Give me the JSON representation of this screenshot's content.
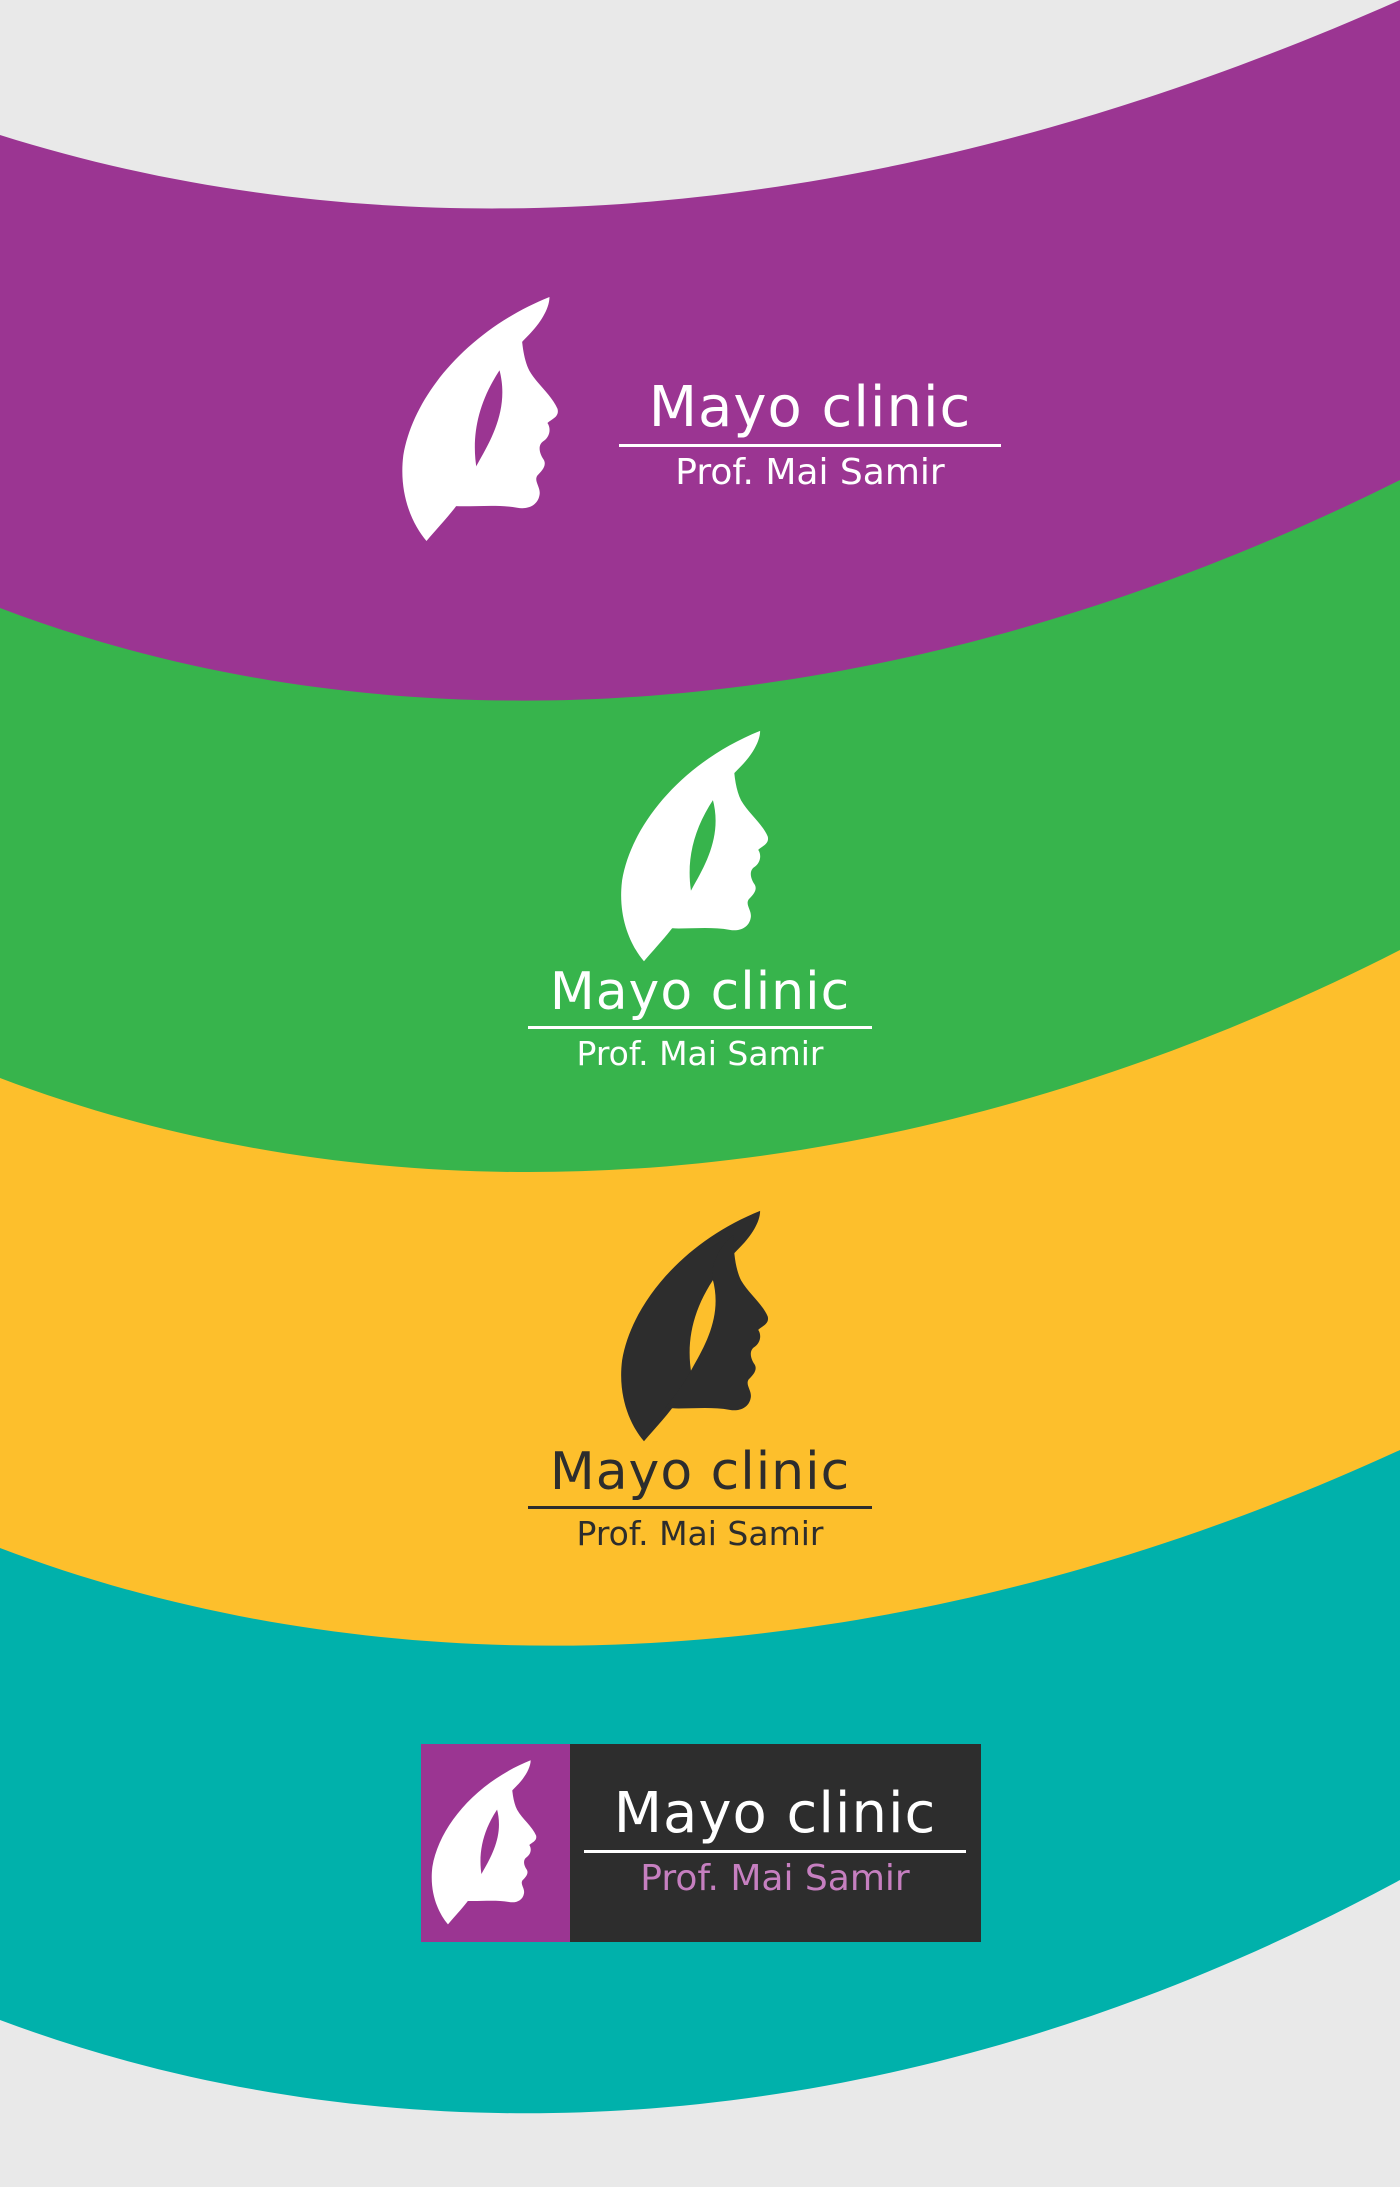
{
  "colors": {
    "background": "#e9e9e9",
    "purple": "#9b3592",
    "green": "#37b44c",
    "yellow": "#fdbf2c",
    "teal": "#00b1ab",
    "dark": "#2d2d2d",
    "white": "#ffffff",
    "pink_text": "#c67fc0"
  },
  "bands": [
    {
      "name": "purple-band",
      "color": "#9b3592"
    },
    {
      "name": "green-band",
      "color": "#37b44c"
    },
    {
      "name": "yellow-band",
      "color": "#fdbf2c"
    },
    {
      "name": "teal-band",
      "color": "#00b1ab"
    }
  ],
  "logos": [
    {
      "icon": "leaf-face-icon",
      "title": "Mayo clinic",
      "subtitle": "Prof. Mai Samir",
      "variant": "white-on-purple"
    },
    {
      "icon": "leaf-face-icon",
      "title": "Mayo clinic",
      "subtitle": "Prof. Mai Samir",
      "variant": "white-on-green"
    },
    {
      "icon": "leaf-face-icon",
      "title": "Mayo clinic",
      "subtitle": "Prof. Mai Samir",
      "variant": "dark-on-yellow"
    },
    {
      "icon": "leaf-face-icon",
      "title": "Mayo clinic",
      "subtitle": "Prof. Mai Samir",
      "variant": "boxed-purple-dark"
    }
  ]
}
